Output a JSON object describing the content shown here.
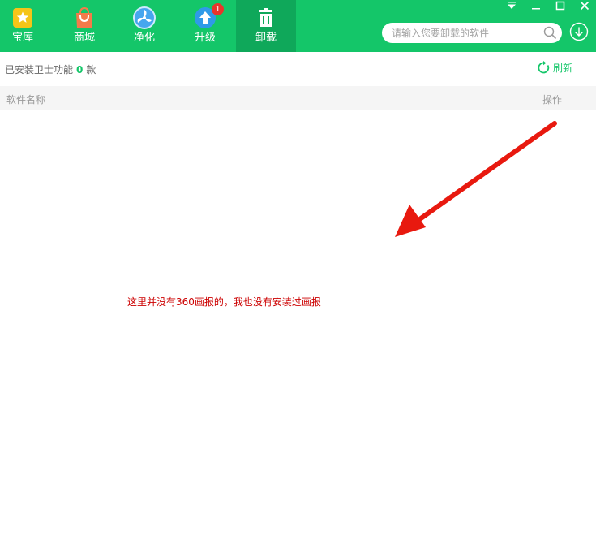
{
  "nav": {
    "tabs": [
      {
        "label": "宝库",
        "icon": "star-icon",
        "color": "#f5c518"
      },
      {
        "label": "商城",
        "icon": "shopping-bag-icon",
        "color": "#f47a4a"
      },
      {
        "label": "净化",
        "icon": "fan-icon",
        "color": "#46a6ee"
      },
      {
        "label": "升级",
        "icon": "upgrade-arrow-icon",
        "color": "#2f9ae8",
        "badge": "1"
      },
      {
        "label": "卸载",
        "icon": "trash-icon",
        "active": true
      }
    ]
  },
  "search": {
    "placeholder": "请输入您要卸载的软件",
    "value": ""
  },
  "info": {
    "prefix": "已安装卫士功能",
    "count": "0",
    "suffix": "款"
  },
  "refresh": {
    "label": "刷新",
    "icon": "refresh-icon"
  },
  "table": {
    "columns": {
      "name": "软件名称",
      "ops": "操作"
    },
    "rows": []
  },
  "annotation": {
    "text": "这里并没有360画报的，我也没有安装过画报",
    "color": "#cc0000"
  },
  "colors": {
    "brand": "#14c669",
    "active_tab": "#0fa85a"
  }
}
